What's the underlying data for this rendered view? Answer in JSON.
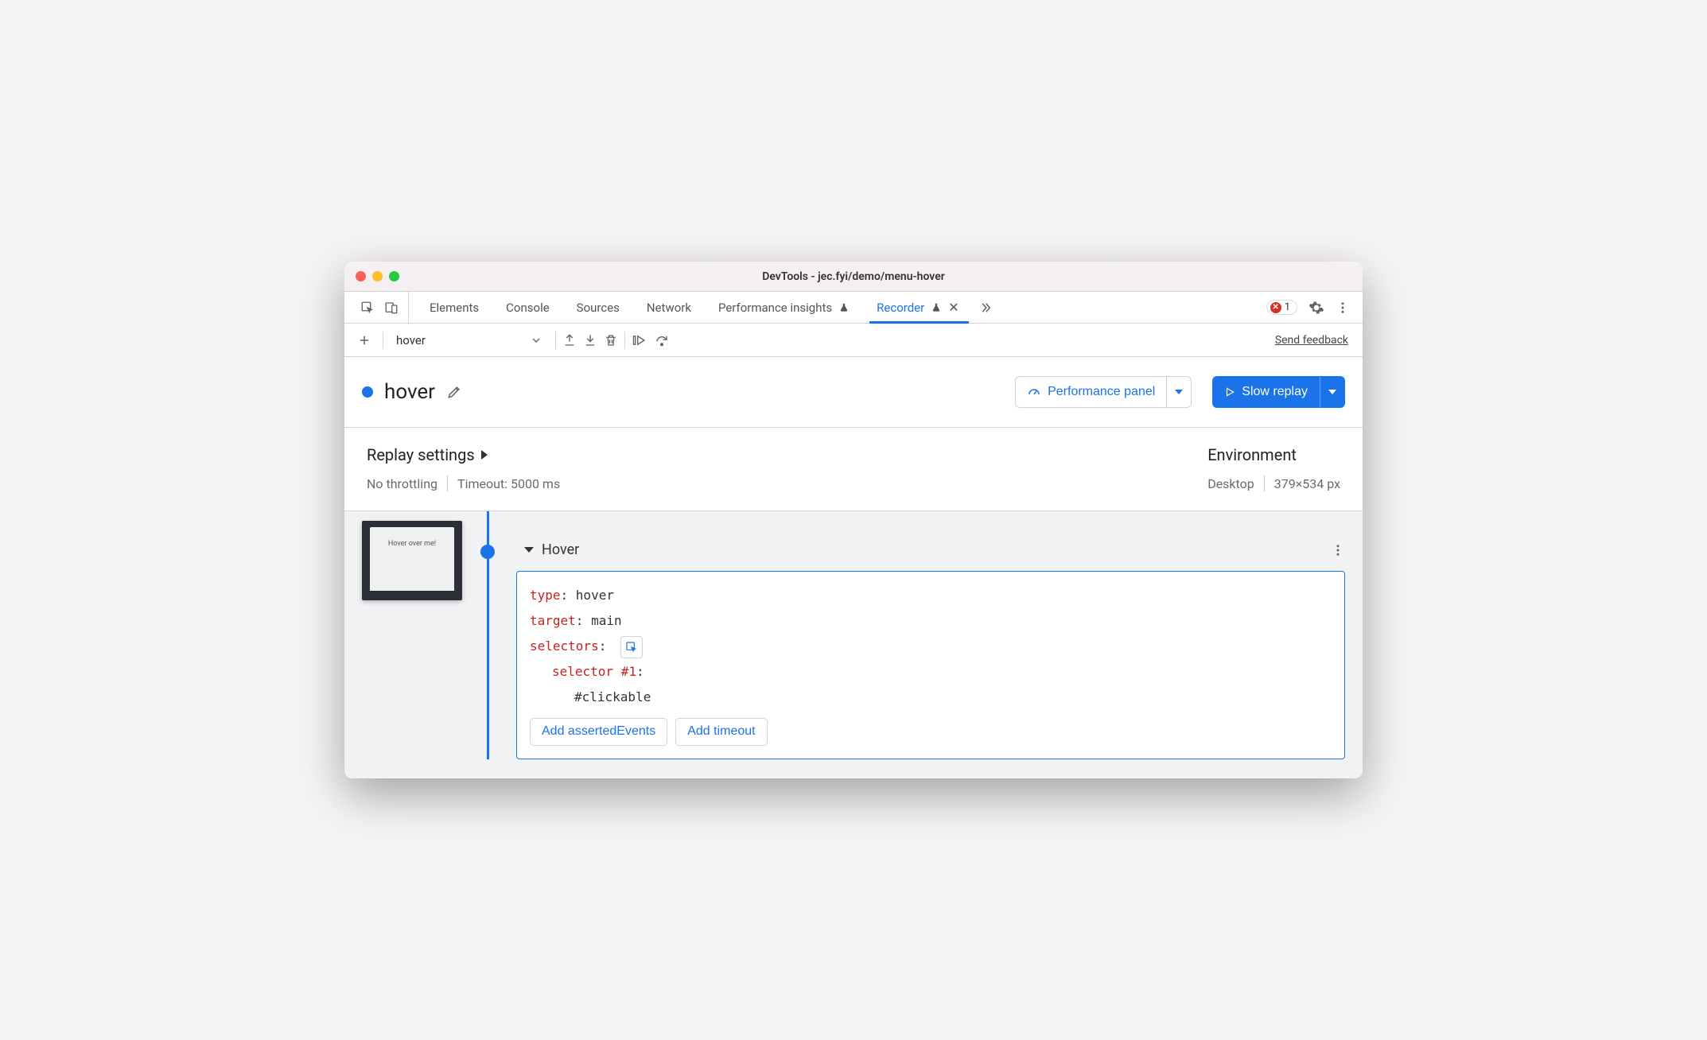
{
  "window": {
    "title": "DevTools - jec.fyi/demo/menu-hover"
  },
  "tabs": {
    "items": [
      {
        "label": "Elements"
      },
      {
        "label": "Console"
      },
      {
        "label": "Sources"
      },
      {
        "label": "Network"
      },
      {
        "label": "Performance insights"
      },
      {
        "label": "Recorder"
      }
    ],
    "error_count": "1"
  },
  "toolbar": {
    "select_value": "hover",
    "feedback": "Send feedback"
  },
  "header": {
    "recording_name": "hover",
    "perf_button": "Performance panel",
    "replay_button": "Slow replay"
  },
  "settings": {
    "replay_title": "Replay settings",
    "throttle": "No throttling",
    "timeout": "Timeout: 5000 ms",
    "env_title": "Environment",
    "device": "Desktop",
    "viewport": "379×534 px"
  },
  "thumbnail": {
    "caption": "Hover over me!"
  },
  "step": {
    "title": "Hover",
    "props": {
      "type_key": "type",
      "type_val": "hover",
      "target_key": "target",
      "target_val": "main",
      "selectors_key": "selectors",
      "selector1_key": "selector #1",
      "selector1_val": "#clickable"
    },
    "actions": {
      "add_asserted": "Add assertedEvents",
      "add_timeout": "Add timeout"
    }
  }
}
